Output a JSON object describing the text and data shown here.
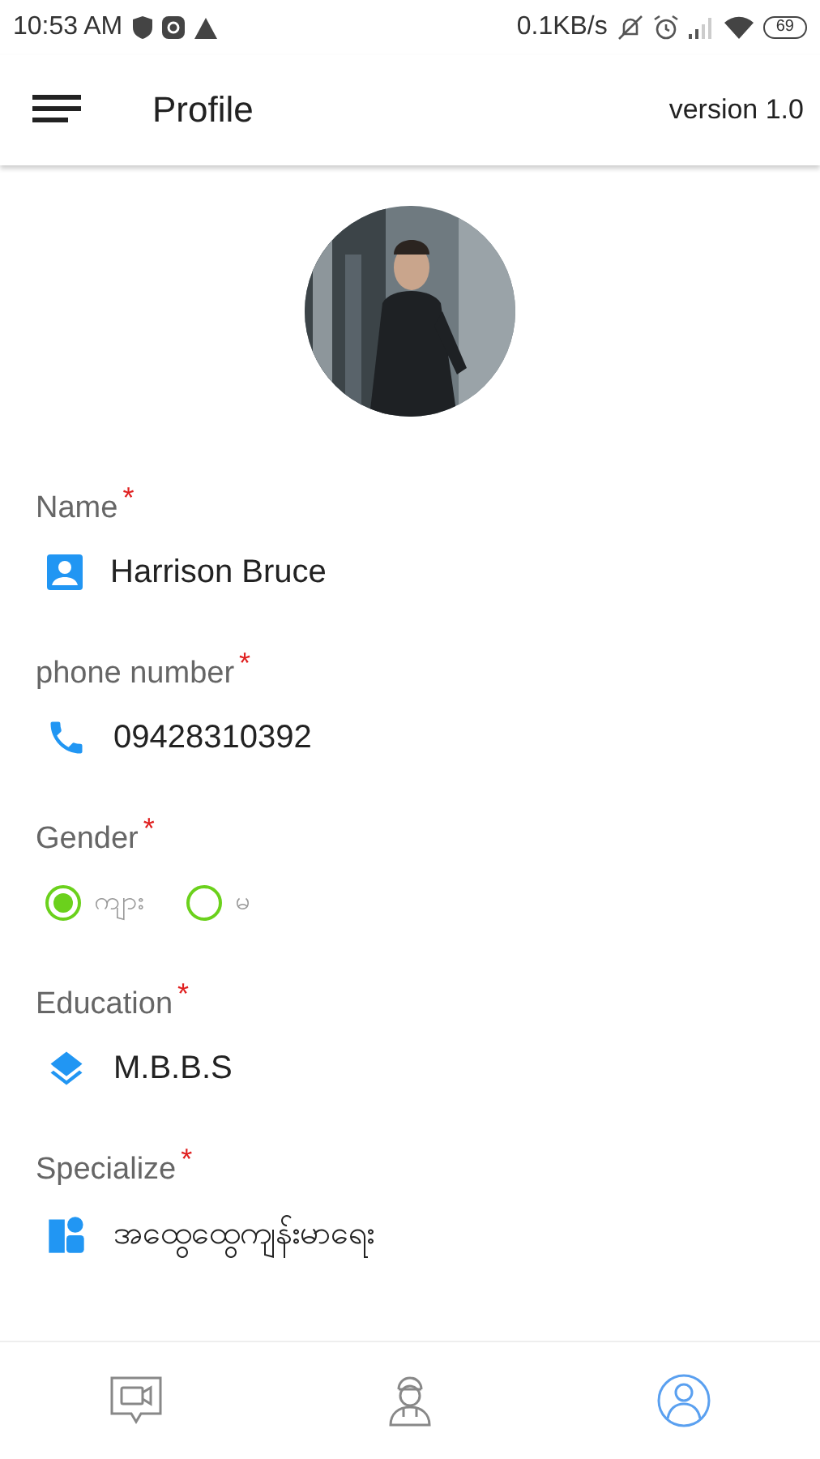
{
  "status_bar": {
    "time": "10:53 AM",
    "speed": "0.1KB/s",
    "battery": "69"
  },
  "app_bar": {
    "title": "Profile",
    "version": "version 1.0"
  },
  "fields": [
    {
      "kind": "text",
      "label": "Name",
      "required": "*",
      "value": "Harrison Bruce"
    },
    {
      "kind": "text",
      "label": "phone number",
      "required": "*",
      "value": "09428310392"
    },
    {
      "kind": "radio",
      "label": "Gender",
      "required": "*",
      "options": [
        {
          "label": "ကျား",
          "selected": true
        },
        {
          "label": "မ",
          "selected": false
        }
      ]
    },
    {
      "kind": "text",
      "label": "Education",
      "required": "*",
      "value": "M.B.B.S"
    },
    {
      "kind": "text",
      "label": "Specialize",
      "required": "*",
      "value": "အထွေထွေကျန်းမာရေး"
    }
  ],
  "bottom_nav": [
    {
      "selected": false
    },
    {
      "selected": false
    },
    {
      "selected": true
    }
  ]
}
